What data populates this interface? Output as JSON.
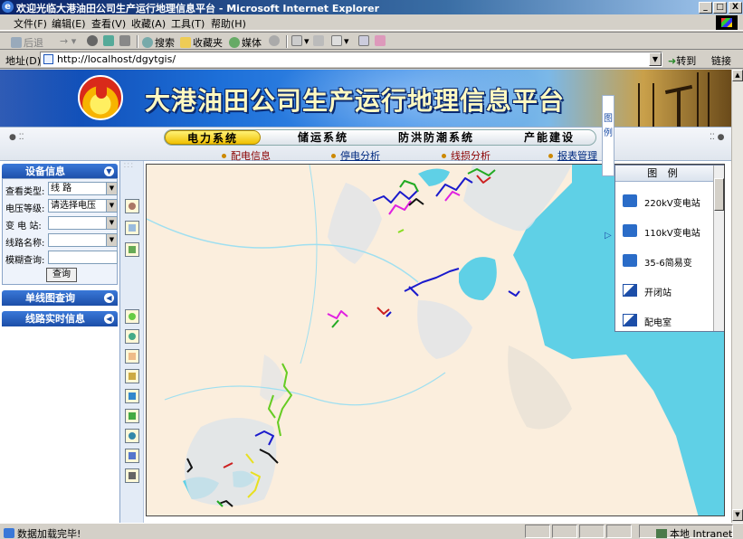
{
  "window": {
    "title": "欢迎光临大港油田公司生产运行地理信息平台 - Microsoft Internet Explorer",
    "controls": [
      "_",
      "□",
      "X"
    ]
  },
  "menu": {
    "items": [
      "文件(F)",
      "编辑(E)",
      "查看(V)",
      "收藏(A)",
      "工具(T)",
      "帮助(H)"
    ]
  },
  "toolbar": {
    "back": "后退",
    "search": "搜索",
    "favorites": "收藏夹",
    "media": "媒体"
  },
  "address": {
    "label": "地址(D)",
    "url": "http://localhost/dgytgis/",
    "go": "转到",
    "links": "链接"
  },
  "banner": {
    "title": "大港油田公司生产运行地理信息平台"
  },
  "nav": {
    "tabs": [
      "电力系统",
      "储运系统",
      "防洪防潮系统",
      "产能建设"
    ],
    "active_tab": "电力系统",
    "subtabs": [
      "配电信息",
      "停电分析",
      "线损分析",
      "报表管理"
    ]
  },
  "sidebar": {
    "device_panel_title": "设备信息",
    "fields": [
      {
        "label": "查看类型:",
        "value": "线  路"
      },
      {
        "label": "电压等级:",
        "value": "请选择电压"
      },
      {
        "label": "变 电 站:",
        "value": ""
      },
      {
        "label": "线路名称:",
        "value": ""
      },
      {
        "label": "模糊查询:",
        "value": ""
      }
    ],
    "query_button": "查询",
    "single_line_panel": "单线图查询",
    "realtime_panel": "线路实时信息"
  },
  "tools": [
    "map-layer",
    "page-view",
    "legend-book",
    "zoom-in",
    "zoom-out",
    "pan-hand",
    "select",
    "identify",
    "layers",
    "globe",
    "measure",
    "print"
  ],
  "legend": {
    "title": "图  例",
    "tab": [
      "图",
      "例"
    ],
    "items": [
      {
        "icon": "substation-220-icon",
        "label": "220kV变电站"
      },
      {
        "icon": "substation-110-icon",
        "label": "110kV变电站"
      },
      {
        "icon": "substation-35-icon",
        "label": "35-6简易变"
      },
      {
        "icon": "switch-station-icon",
        "label": "开闭站"
      },
      {
        "icon": "distribution-room-icon",
        "label": "配电室"
      }
    ]
  },
  "status": {
    "text": "数据加载完毕!",
    "zone": "本地 Intranet"
  },
  "colors": {
    "sea": "#5fd0e6",
    "land": "#fbeedd",
    "urban": "#dde3ea",
    "accent": "#1c4ea8",
    "active_tab": "#f0c000"
  }
}
